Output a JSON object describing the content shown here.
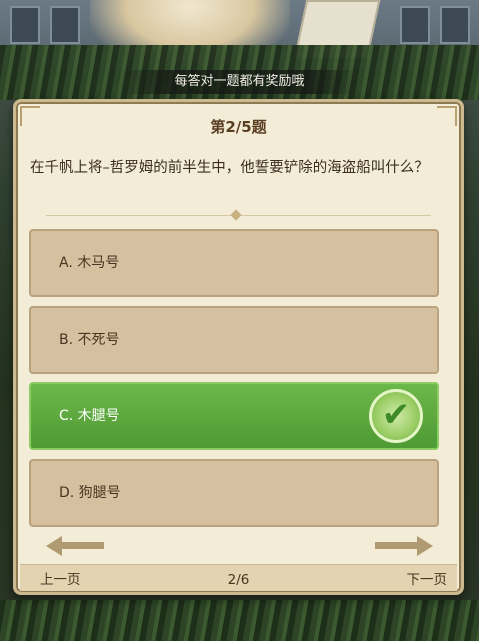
{
  "banner": {
    "text": "每答对一题都有奖励哦"
  },
  "quiz": {
    "question_number": "第2/5题",
    "question": "在千帆上将–哲罗姆的前半生中，他誓要铲除的海盗船叫什么？",
    "options": [
      {
        "label": "A. 木马号",
        "state": "normal"
      },
      {
        "label": "B. 不死号",
        "state": "normal"
      },
      {
        "label": "C. 木腿号",
        "state": "correct"
      },
      {
        "label": "D. 狗腿号",
        "state": "normal"
      }
    ]
  },
  "pager": {
    "prev_label": "上一页",
    "page_indicator": "2/6",
    "next_label": "下一页"
  },
  "colors": {
    "panel_bg": "#f3ecd6",
    "option_bg": "#d5c0a0",
    "correct_bg": "#5aa83e",
    "text": "#3a2e22"
  },
  "icons": {
    "correct": "checkmark-icon",
    "prev": "arrow-left-icon",
    "next": "arrow-right-icon"
  }
}
